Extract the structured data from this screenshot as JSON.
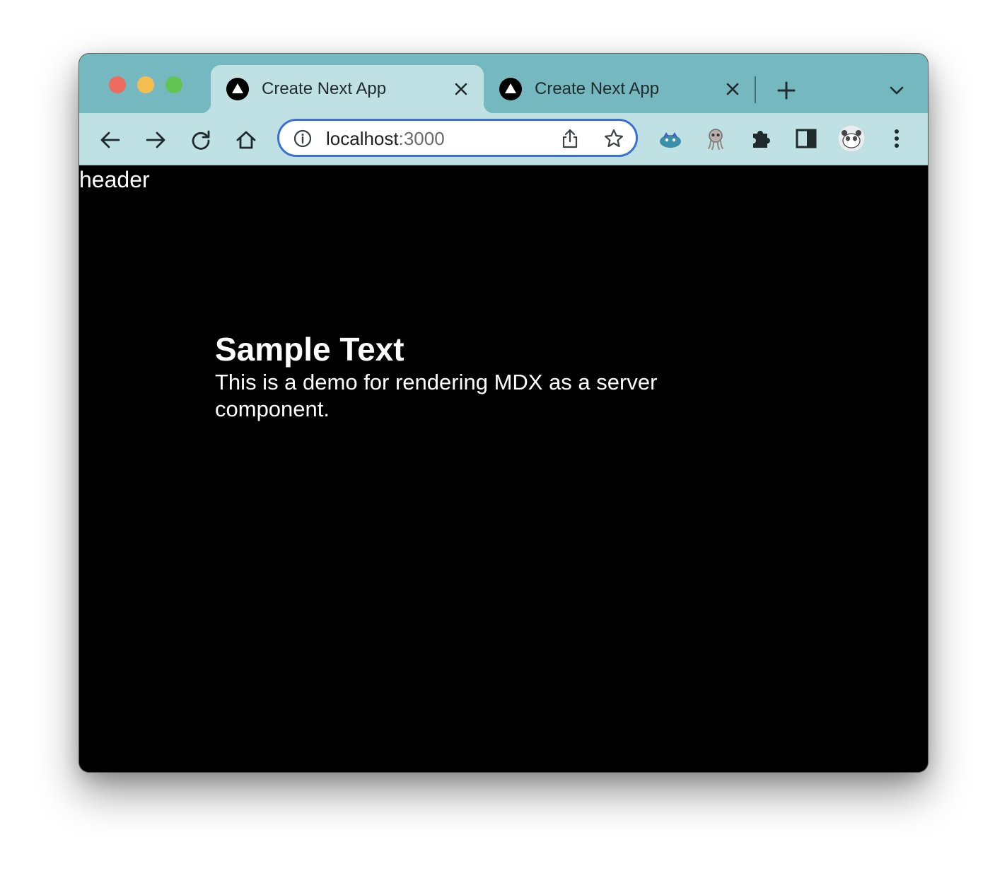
{
  "browser": {
    "tabs": [
      {
        "title": "Create Next App",
        "active": true
      },
      {
        "title": "Create Next App",
        "active": false
      }
    ],
    "address_bar": {
      "host": "localhost",
      "port": ":3000"
    },
    "toolbar_icons": [
      "back-arrow-icon",
      "forward-arrow-icon",
      "reload-icon",
      "home-icon"
    ],
    "extension_icons": [
      "monster-extension-icon",
      "octopus-extension-icon",
      "puzzle-extensions-icon",
      "side-panel-icon",
      "profile-avatar-icon",
      "kebab-menu-icon"
    ],
    "colors": {
      "tabstrip": "#75b8c0",
      "toolbar": "#bfe1e4",
      "focus_ring": "#3b6fd4"
    }
  },
  "page": {
    "header_text": "header",
    "title": "Sample Text",
    "body": "This is a demo for rendering MDX as a server component.",
    "background": "#000000",
    "text_color": "#ffffff"
  }
}
